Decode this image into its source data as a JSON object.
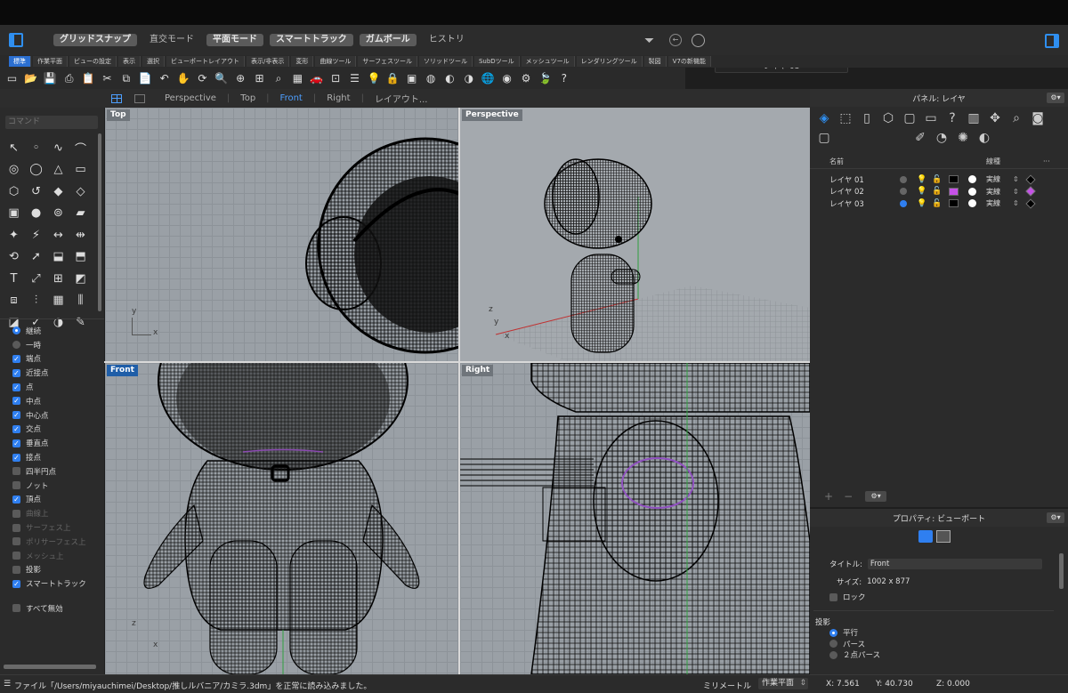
{
  "titlebar": {
    "modes": [
      {
        "label": "グリッドスナップ",
        "on": true
      },
      {
        "label": "直交モード",
        "on": false
      },
      {
        "label": "平面モード",
        "on": true
      },
      {
        "label": "スマートトラック",
        "on": true
      },
      {
        "label": "ガムボール",
        "on": true
      },
      {
        "label": "ヒストリ",
        "on": false
      }
    ],
    "current_layer": "レイヤ 03"
  },
  "tabs": [
    "標準",
    "作業平面",
    "ビューの設定",
    "表示",
    "選択",
    "ビューポートレイアウト",
    "表示/非表示",
    "変形",
    "曲線ツール",
    "サーフェスツール",
    "ソリッドツール",
    "SubDツール",
    "メッシュツール",
    "レンダリングツール",
    "製図",
    "V7の新機能"
  ],
  "toolbar_icons": [
    "new-file-icon",
    "open-folder-icon",
    "save-icon",
    "print-icon",
    "clipboard-icon",
    "cut-icon",
    "copy-icon",
    "paste-icon",
    "undo-icon",
    "hand-pan-icon",
    "rotate-view-icon",
    "zoom-icon",
    "zoom-window-icon",
    "zoom-extents-icon",
    "zoom-selected-icon",
    "viewport-4-icon",
    "car-icon",
    "grid-options-icon",
    "layer-icon",
    "bulb-icon",
    "lock-icon",
    "properties-icon",
    "color-wheel-icon",
    "shaded-icon",
    "rendered-icon",
    "globe-icon",
    "material-icon",
    "settings-icon",
    "leaf-icon",
    "help-icon"
  ],
  "command_placeholder": "コマンド",
  "viewport_tabs": [
    "Perspective",
    "Top",
    "Front",
    "Right",
    "レイアウト..."
  ],
  "active_viewport_tab": "Front",
  "viewports": {
    "top": "Top",
    "perspective": "Perspective",
    "front": "Front",
    "right": "Right"
  },
  "osnaps": [
    {
      "label": "継続",
      "type": "radio",
      "on": true
    },
    {
      "label": "一時",
      "type": "radio",
      "on": false
    },
    {
      "label": "端点",
      "type": "check",
      "on": true
    },
    {
      "label": "近接点",
      "type": "check",
      "on": true
    },
    {
      "label": "点",
      "type": "check",
      "on": true
    },
    {
      "label": "中点",
      "type": "check",
      "on": true
    },
    {
      "label": "中心点",
      "type": "check",
      "on": true
    },
    {
      "label": "交点",
      "type": "check",
      "on": true
    },
    {
      "label": "垂直点",
      "type": "check",
      "on": true
    },
    {
      "label": "接点",
      "type": "check",
      "on": true
    },
    {
      "label": "四半円点",
      "type": "check",
      "on": false
    },
    {
      "label": "ノット",
      "type": "check",
      "on": false
    },
    {
      "label": "頂点",
      "type": "check",
      "on": true
    },
    {
      "label": "曲線上",
      "type": "check",
      "on": false,
      "dim": true
    },
    {
      "label": "サーフェス上",
      "type": "check",
      "on": false,
      "dim": true
    },
    {
      "label": "ポリサーフェス上",
      "type": "check",
      "on": false,
      "dim": true
    },
    {
      "label": "メッシュ上",
      "type": "check",
      "on": false,
      "dim": true
    },
    {
      "label": "投影",
      "type": "check",
      "on": false
    },
    {
      "label": "スマートトラック",
      "type": "check",
      "on": true
    }
  ],
  "osnap_disable_all": "すべて無効",
  "layer_panel": {
    "title": "パネル: レイヤ",
    "col_name": "名前",
    "col_linetype": "線種",
    "col_more": "···",
    "layers": [
      {
        "name": "レイヤ 01",
        "current": false,
        "color": "#000000",
        "linetype": "実線",
        "print_color": "#000000"
      },
      {
        "name": "レイヤ 02",
        "current": false,
        "color": "#c651e8",
        "linetype": "実線",
        "print_color": "#c651e8"
      },
      {
        "name": "レイヤ 03",
        "current": true,
        "color": "#000000",
        "linetype": "実線",
        "print_color": "#000000"
      }
    ]
  },
  "props_panel": {
    "title": "プロパティ: ビューポート",
    "title_label": "タイトル:",
    "title_value": "Front",
    "size_label": "サイズ:",
    "size_value": "1002 x 877",
    "lock_label": "ロック",
    "projection_label": "投影",
    "projections": [
      {
        "label": "平行",
        "on": true
      },
      {
        "label": "パース",
        "on": false
      },
      {
        "label": "２点パース",
        "on": false
      }
    ]
  },
  "status": {
    "message": "ファイル「/Users/miyauchimei/Desktop/推しルバニア/カミラ.3dm」を正常に読み込みました。",
    "units": "ミリメートル",
    "cplane": "作業平面",
    "x": "X: 7.561",
    "y": "Y: 40.730",
    "z": "Z: 0.000"
  }
}
